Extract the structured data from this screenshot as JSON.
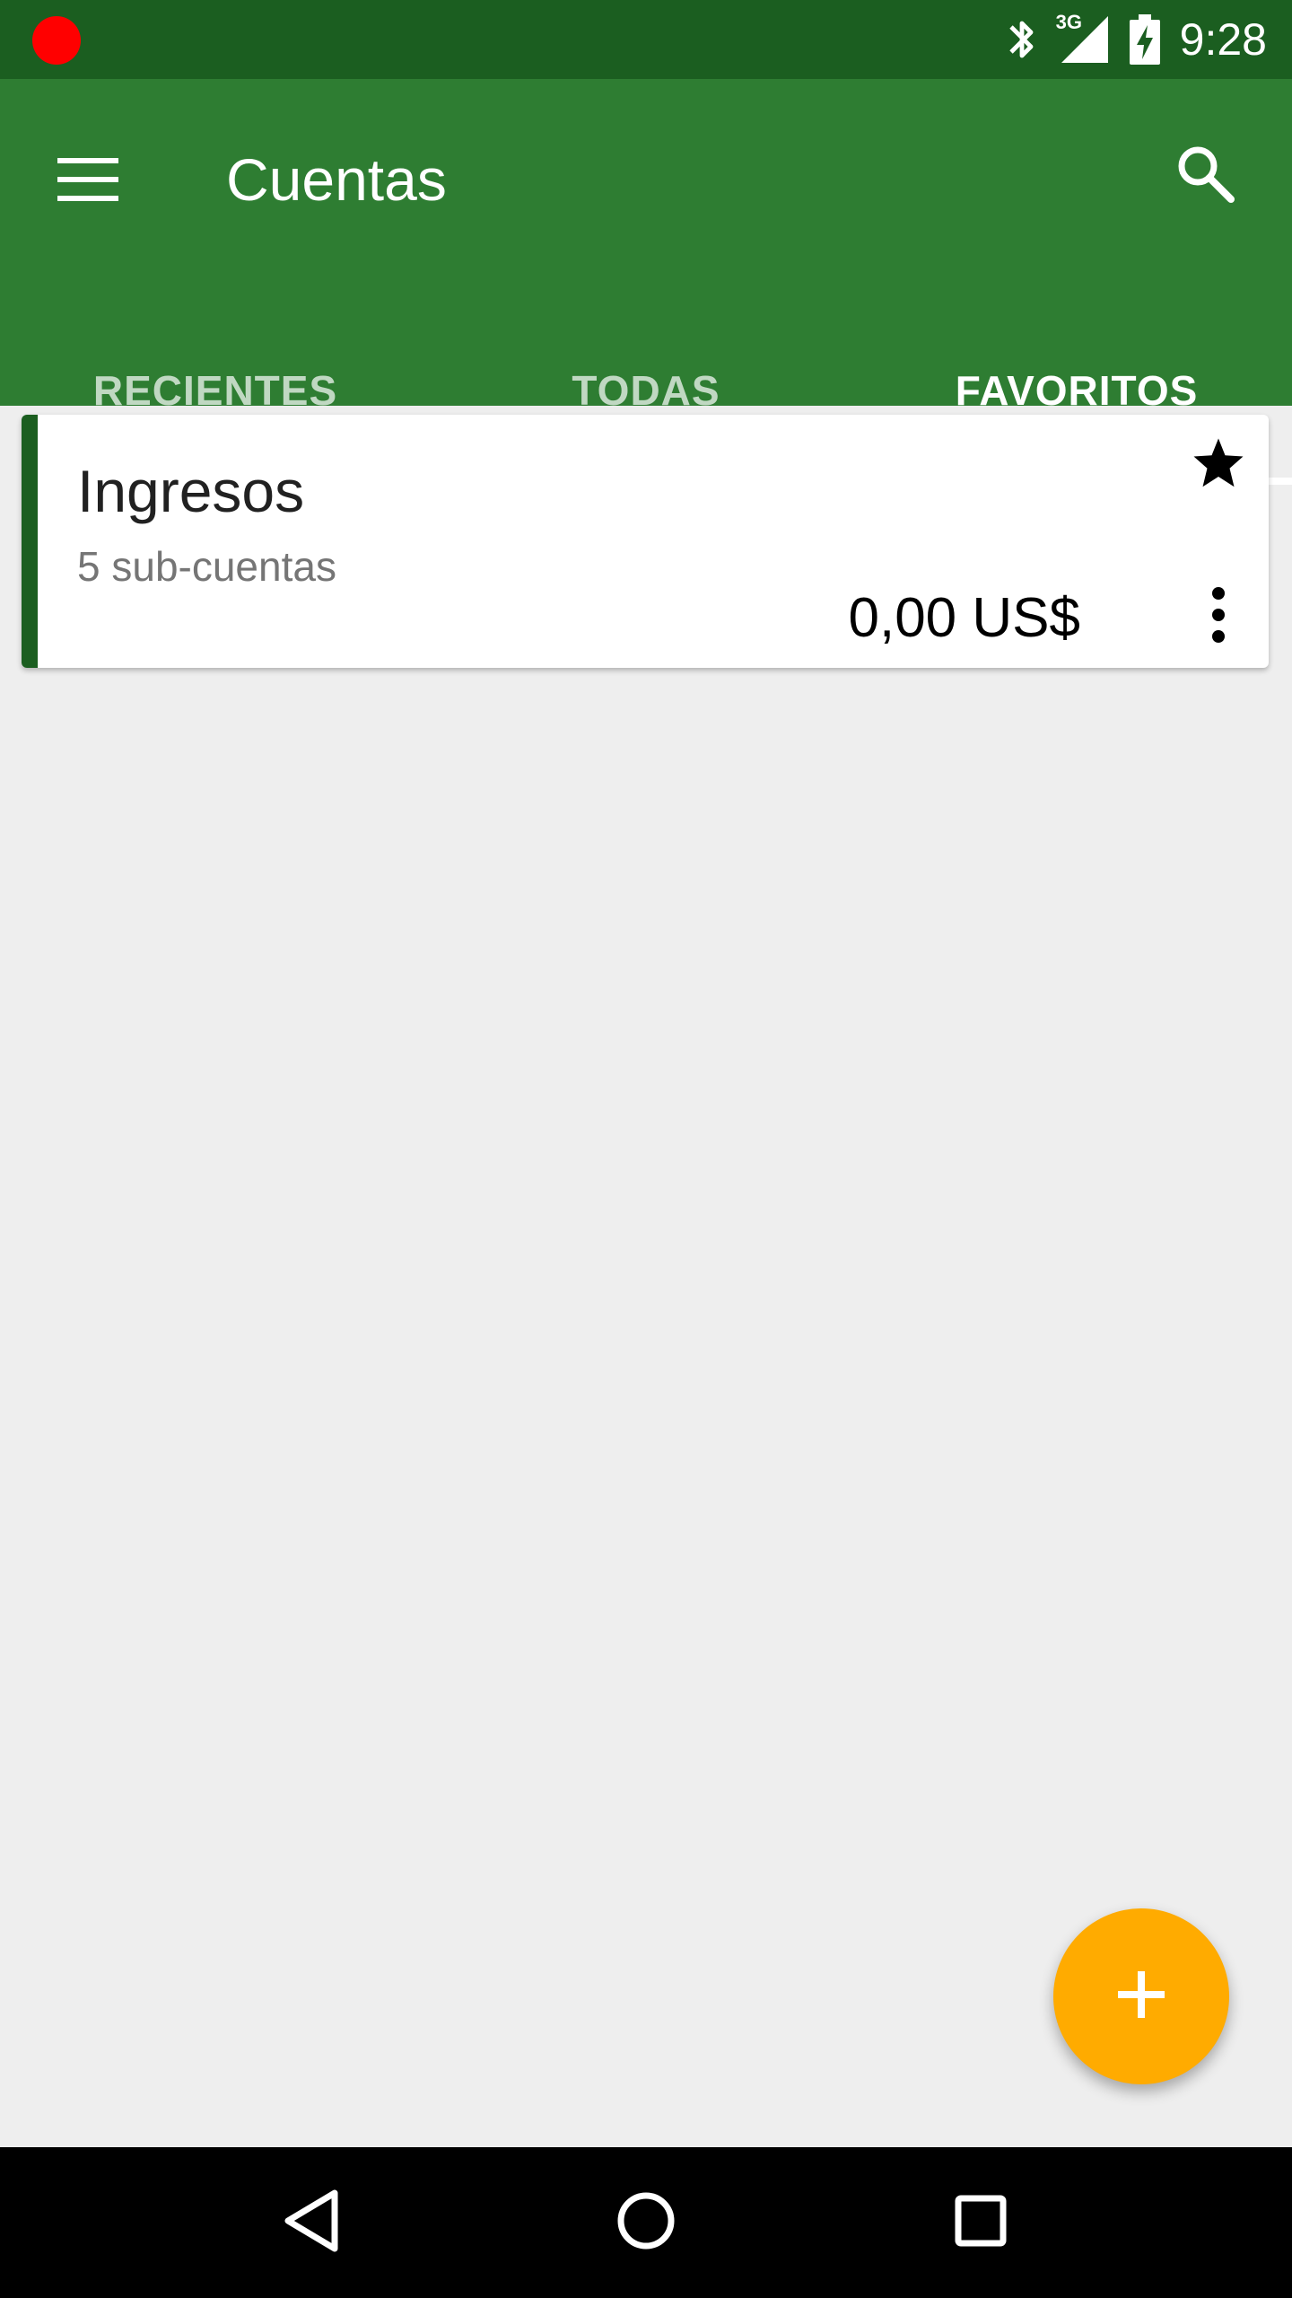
{
  "status_bar": {
    "time": "9:28",
    "network_label": "3G",
    "icons": [
      "recording-icon",
      "bluetooth-icon",
      "signal-icon",
      "battery-charging-icon"
    ]
  },
  "app_bar": {
    "title": "Cuentas",
    "menu_icon": "menu-icon",
    "search_icon": "search-icon"
  },
  "tabs": [
    {
      "label": "RECIENTES",
      "active": false
    },
    {
      "label": "TODAS",
      "active": false
    },
    {
      "label": "FAVORITOS",
      "active": true
    }
  ],
  "accounts": [
    {
      "name": "Ingresos",
      "subtitle": "5 sub-cuentas",
      "balance": "0,00 US$",
      "favorite": true,
      "accent_color": "#1b5e20"
    }
  ],
  "fab": {
    "icon": "plus-icon",
    "color": "#ffab00"
  },
  "colors": {
    "primary": "#2e7d32",
    "primary_dark": "#1b5e20",
    "accent": "#ffab00",
    "background": "#eeeeee"
  },
  "nav_bar": {
    "icons": [
      "back-icon",
      "home-icon",
      "recents-icon"
    ]
  }
}
